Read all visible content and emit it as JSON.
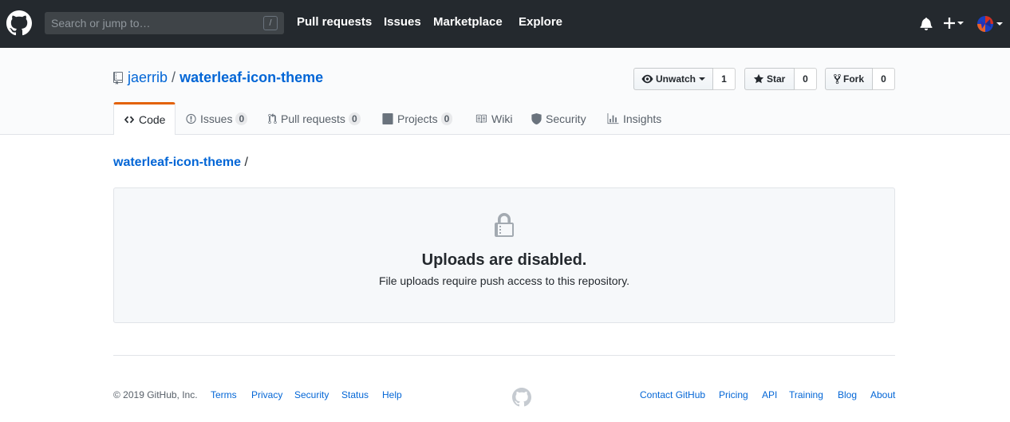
{
  "header": {
    "search_placeholder": "Search or jump to…",
    "search_shortcut": "/",
    "nav": [
      "Pull requests",
      "Issues",
      "Marketplace",
      "Explore"
    ],
    "icons": [
      "github-logo-icon",
      "bell-icon",
      "plus-icon",
      "avatar"
    ]
  },
  "repo": {
    "owner": "jaerrib",
    "separator": "/",
    "name": "waterleaf-icon-theme",
    "actions": {
      "watch": {
        "label": "Unwatch",
        "count": "1"
      },
      "star": {
        "label": "Star",
        "count": "0"
      },
      "fork": {
        "label": "Fork",
        "count": "0"
      }
    },
    "tabs": [
      {
        "label": "Code",
        "selected": true
      },
      {
        "label": "Issues",
        "count": "0"
      },
      {
        "label": "Pull requests",
        "count": "0"
      },
      {
        "label": "Projects",
        "count": "0"
      },
      {
        "label": "Wiki"
      },
      {
        "label": "Security"
      },
      {
        "label": "Insights"
      }
    ]
  },
  "main": {
    "breadcrumb_repo": "waterleaf-icon-theme",
    "breadcrumb_sep": "/",
    "blank_title": "Uploads are disabled.",
    "blank_text": "File uploads require push access to this repository."
  },
  "footer": {
    "copyright": "© 2019 GitHub, Inc.",
    "left_links": [
      "Terms",
      "Privacy",
      "Security",
      "Status",
      "Help"
    ],
    "right_links": [
      "Contact GitHub",
      "Pricing",
      "API",
      "Training",
      "Blog",
      "About"
    ]
  },
  "colors": {
    "header_bg": "#24292e",
    "link": "#0366d6",
    "tab_accent": "#e36209",
    "repo_head_bg": "#fafbfc",
    "blankslate_bg": "#f6f8fa"
  }
}
